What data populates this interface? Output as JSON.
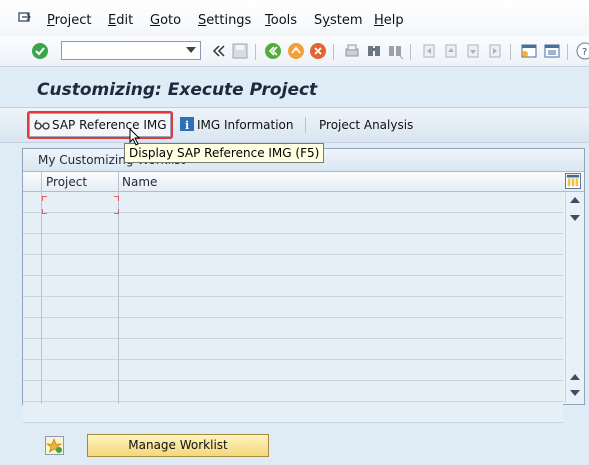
{
  "menubar": {
    "items": [
      {
        "label": "Project",
        "u": "P"
      },
      {
        "label": "Edit",
        "u": "E"
      },
      {
        "label": "Goto",
        "u": "G"
      },
      {
        "label": "Settings",
        "u": "S"
      },
      {
        "label": "Tools",
        "u": "T"
      },
      {
        "label": "System",
        "u": "y"
      },
      {
        "label": "Help",
        "u": "H"
      }
    ]
  },
  "toolbar": {
    "command_value": "",
    "icons": [
      "enter-icon",
      "back-double-arrow-icon",
      "save-icon",
      "back-icon",
      "exit-icon",
      "cancel-icon",
      "print-icon",
      "find-icon",
      "find-next-icon",
      "first-page-icon",
      "previous-page-icon",
      "next-page-icon",
      "last-page-icon",
      "create-session-icon",
      "shortcut-icon",
      "help-icon"
    ]
  },
  "title": "Customizing: Execute Project",
  "apptoolbar": {
    "sap_reference_img": "SAP Reference IMG",
    "img_information": "IMG Information",
    "project_analysis": "Project Analysis"
  },
  "tooltip": "Display SAP Reference IMG   (F5)",
  "worklist": {
    "title": "My Customizing Worklist",
    "columns": [
      "Project",
      "Name"
    ],
    "rows": [
      "",
      "",
      "",
      "",
      "",
      "",
      "",
      "",
      "",
      "",
      ""
    ]
  },
  "footer": {
    "manage_worklist": "Manage Worklist"
  },
  "colors": {
    "background": "#dfebf5",
    "highlight_red": "#e2393a",
    "manage_button": "#f3d77a"
  }
}
